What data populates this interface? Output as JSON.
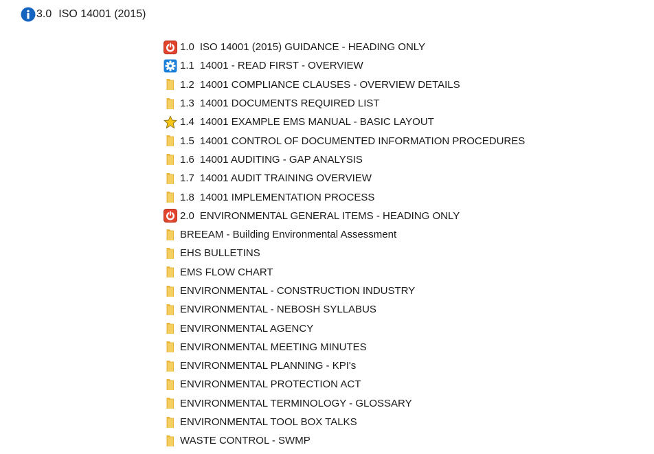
{
  "header": {
    "number": "3.0",
    "title": "ISO 14001 (2015)",
    "icon": "info-icon",
    "icon_color": "#1565c0"
  },
  "items": [
    {
      "icon": "power-icon",
      "number": "1.0",
      "label": "ISO 14001 (2015) GUIDANCE - HEADING ONLY"
    },
    {
      "icon": "gear-icon",
      "number": "1.1",
      "label": "14001 - READ FIRST - OVERVIEW"
    },
    {
      "icon": "folder-icon",
      "number": "1.2",
      "label": "14001 COMPLIANCE CLAUSES - OVERVIEW DETAILS"
    },
    {
      "icon": "folder-icon",
      "number": "1.3",
      "label": "14001 DOCUMENTS REQUIRED LIST"
    },
    {
      "icon": "star-icon",
      "number": "1.4",
      "label": "14001 EXAMPLE EMS MANUAL - BASIC LAYOUT"
    },
    {
      "icon": "folder-icon",
      "number": "1.5",
      "label": "14001 CONTROL OF DOCUMENTED INFORMATION PROCEDURES"
    },
    {
      "icon": "folder-icon",
      "number": "1.6",
      "label": "14001 AUDITING - GAP ANALYSIS"
    },
    {
      "icon": "folder-icon",
      "number": "1.7",
      "label": "14001 AUDIT TRAINING OVERVIEW"
    },
    {
      "icon": "folder-icon",
      "number": "1.8",
      "label": "14001 IMPLEMENTATION PROCESS"
    },
    {
      "icon": "power-icon",
      "number": "2.0",
      "label": "ENVIRONMENTAL GENERAL ITEMS - HEADING ONLY"
    },
    {
      "icon": "folder-icon",
      "number": "",
      "label": "BREEAM -  Building Environmental Assessment"
    },
    {
      "icon": "folder-icon",
      "number": "",
      "label": "EHS BULLETINS"
    },
    {
      "icon": "folder-icon",
      "number": "",
      "label": "EMS FLOW CHART"
    },
    {
      "icon": "folder-icon",
      "number": "",
      "label": "ENVIRONMENTAL - CONSTRUCTION INDUSTRY"
    },
    {
      "icon": "folder-icon",
      "number": "",
      "label": "ENVIRONMENTAL - NEBOSH SYLLABUS"
    },
    {
      "icon": "folder-icon",
      "number": "",
      "label": "ENVIRONMENTAL AGENCY"
    },
    {
      "icon": "folder-icon",
      "number": "",
      "label": "ENVIRONMENTAL MEETING MINUTES"
    },
    {
      "icon": "folder-icon",
      "number": "",
      "label": "ENVIRONMENTAL PLANNING - KPI's"
    },
    {
      "icon": "folder-icon",
      "number": "",
      "label": "ENVIRONMENTAL PROTECTION ACT"
    },
    {
      "icon": "folder-icon",
      "number": "",
      "label": "ENVIRONMENTAL TERMINOLOGY - GLOSSARY"
    },
    {
      "icon": "folder-icon",
      "number": "",
      "label": "ENVIRONMENTAL TOOL BOX TALKS"
    },
    {
      "icon": "folder-icon",
      "number": "",
      "label": "WASTE CONTROL - SWMP"
    }
  ],
  "colors": {
    "power": "#e0442c",
    "gear": "#1e7fd8",
    "star": "#f5c518",
    "folder": "#f2c14e"
  }
}
